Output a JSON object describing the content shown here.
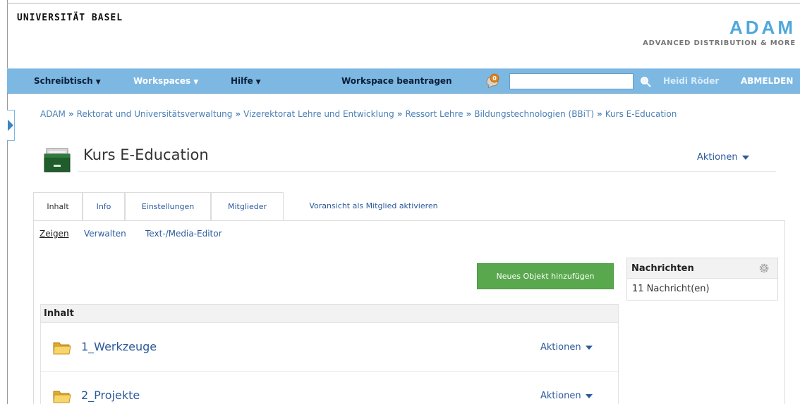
{
  "header": {
    "university": "UNIVERSITÄT BASEL",
    "app_name": "ADAM",
    "app_subtitle": "ADVANCED DISTRIBUTION & MORE"
  },
  "nav": {
    "items": [
      {
        "label": "Schreibtisch",
        "caret": "▼"
      },
      {
        "label": "Workspaces",
        "caret": "▼"
      },
      {
        "label": "Hilfe",
        "caret": "▼"
      }
    ],
    "workspace_request": "Workspace beantragen",
    "notification_count": "0",
    "search_value": "",
    "user_name": "Heidi Röder",
    "logout": "ABMELDEN"
  },
  "breadcrumb": {
    "items": [
      "ADAM",
      "Rektorat und Universitätsverwaltung",
      "Vizerektorat Lehre und Entwicklung",
      "Ressort Lehre",
      "Bildungstechnologien (BBiT)",
      "Kurs E-Education"
    ],
    "separator": "»"
  },
  "page": {
    "title": "Kurs E-Education",
    "actions_label": "Aktionen"
  },
  "tabs": [
    {
      "label": "Inhalt",
      "active": true
    },
    {
      "label": "Info"
    },
    {
      "label": "Einstellungen"
    },
    {
      "label": "Mitglieder"
    },
    {
      "label": "Voransicht als Mitglied aktivieren"
    }
  ],
  "subtabs": [
    {
      "label": "Zeigen",
      "active": true
    },
    {
      "label": "Verwalten"
    },
    {
      "label": "Text-/Media-Editor"
    }
  ],
  "new_object_button": "Neues Objekt hinzufügen",
  "content_list": {
    "header": "Inhalt",
    "items": [
      {
        "title": "1_Werkzeuge",
        "actions": "Aktionen"
      },
      {
        "title": "2_Projekte",
        "actions": "Aktionen"
      }
    ]
  },
  "news": {
    "title": "Nachrichten",
    "count_text": "11 Nachricht(en)"
  },
  "colors": {
    "nav_bar": "#7db8e2",
    "link": "#2b5a9b",
    "button_green": "#5aa84e",
    "logo_blue": "#4fa8dc"
  }
}
